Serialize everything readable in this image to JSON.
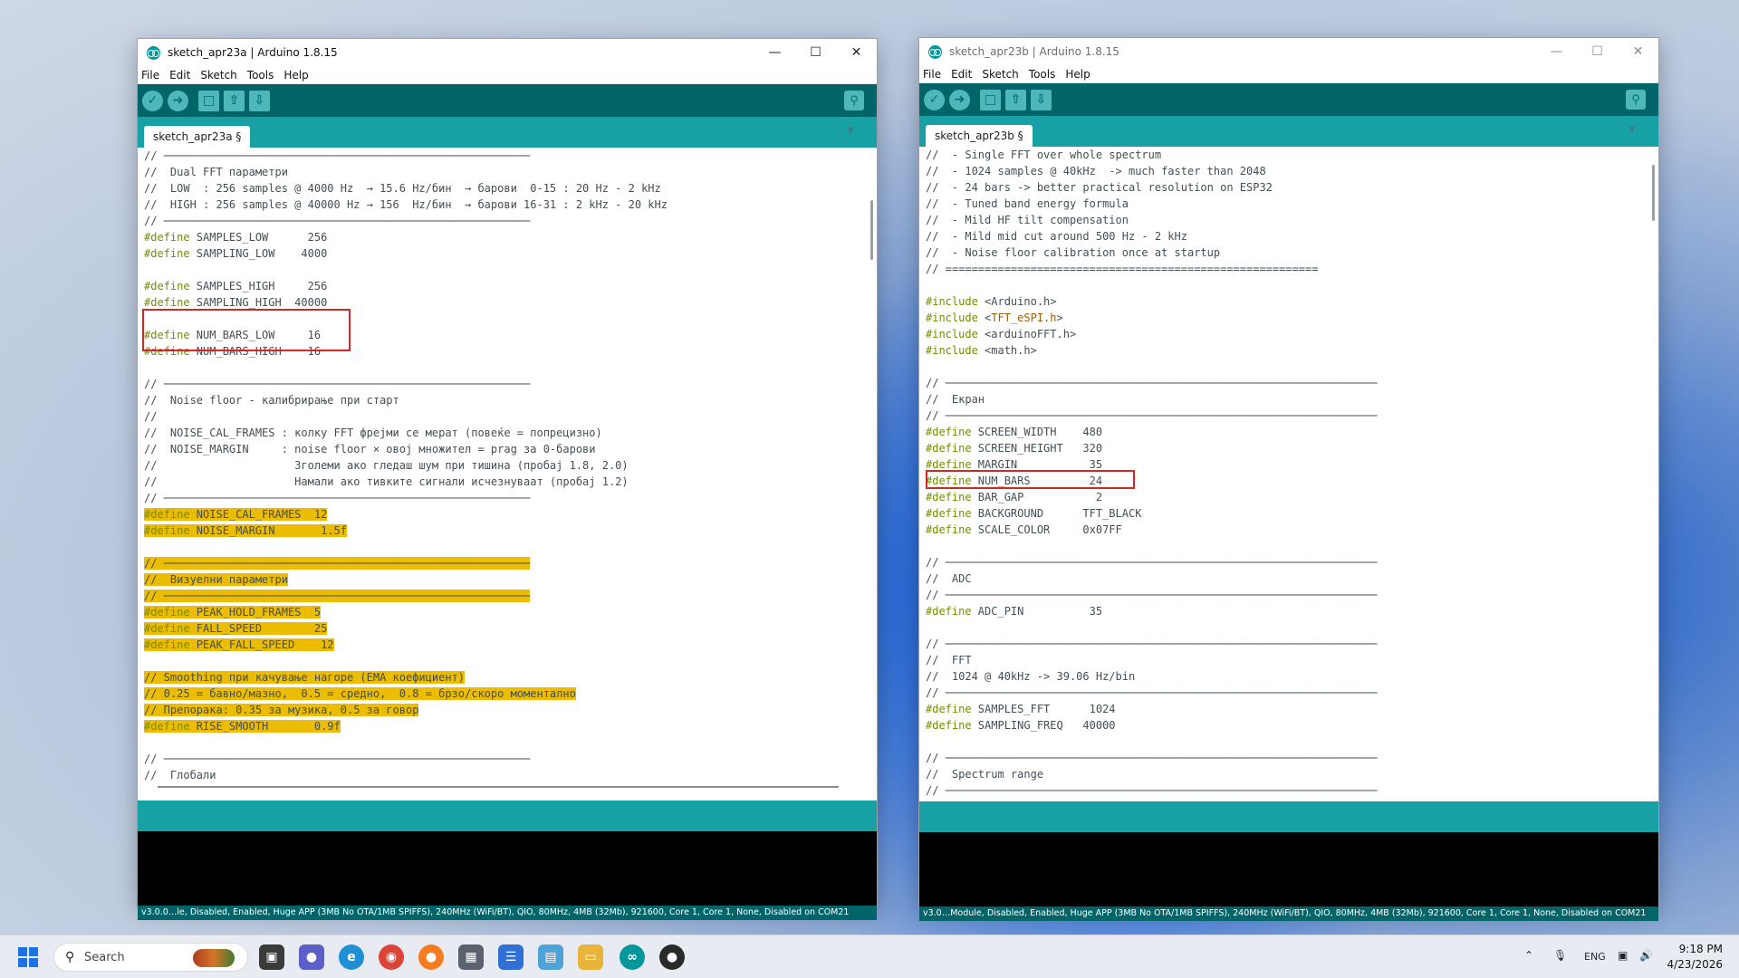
{
  "windows": [
    {
      "title": "sketch_apr23a | Arduino 1.8.15",
      "menu": [
        "File",
        "Edit",
        "Sketch",
        "Tools",
        "Help"
      ],
      "tab": "sketch_apr23a §",
      "footer": "v3.0.0…le, Disabled, Enabled, Huge APP (3MB No OTA/1MB SPIFFS), 240MHz (WiFi/BT), QIO, 80MHz, 4MB (32Mb), 921600, Core 1, Core 1, None, Disabled on COM21",
      "code": [
        "// ────────────────────────────────────────────────────────",
        "//  Dual FFT параметри",
        "//  LOW  : 256 samples @ 4000 Hz  → 15.6 Hz/бин  → барови  0-15 : 20 Hz - 2 kHz",
        "//  HIGH : 256 samples @ 40000 Hz → 156  Hz/бин  → барови 16-31 : 2 kHz - 20 kHz",
        "// ────────────────────────────────────────────────────────",
        "#define SAMPLES_LOW      256",
        "#define SAMPLING_LOW    4000",
        "",
        "#define SAMPLES_HIGH     256",
        "#define SAMPLING_HIGH  40000",
        "",
        "#define NUM_BARS_LOW     16",
        "#define NUM_BARS_HIGH    16",
        "",
        "// ────────────────────────────────────────────────────────",
        "//  Noise floor - калибрирање при старт",
        "//",
        "//  NOISE_CAL_FRAMES : колку FFT фрејми се мерат (повеќе = попрецизно)",
        "//  NOISE_MARGIN     : noise floor × овој множител = prag за 0-барови",
        "//                     Зголеми ако гледаш шум при тишина (пробај 1.8, 2.0)",
        "//                     Намали ако тивките сигнали исчезнуваат (пробај 1.2)",
        "// ────────────────────────────────────────────────────────",
        "#define NOISE_CAL_FRAMES  12",
        "#define NOISE_MARGIN       1.5f",
        "",
        "// ────────────────────────────────────────────────────────",
        "//  Визуелни параметри",
        "// ────────────────────────────────────────────────────────",
        "#define PEAK_HOLD_FRAMES  5",
        "#define FALL_SPEED        25",
        "#define PEAK_FALL_SPEED    12",
        "",
        "// Smoothing при качување нагоре (EMA коефициент)",
        "// 0.25 = бавно/мазно,  0.5 = средно,  0.8 = брзо/скоро моментално",
        "// Препорака: 0.35 за музика, 0.5 за говор",
        "#define RISE_SMOOTH       0.9f",
        "",
        "// ────────────────────────────────────────────────────────",
        "//  Глобали"
      ]
    },
    {
      "title": "sketch_apr23b | Arduino 1.8.15",
      "menu": [
        "File",
        "Edit",
        "Sketch",
        "Tools",
        "Help"
      ],
      "tab": "sketch_apr23b §",
      "footer": "v3.0…Module, Disabled, Enabled, Huge APP (3MB No OTA/1MB SPIFFS), 240MHz (WiFi/BT), QIO, 80MHz, 4MB (32Mb), 921600, Core 1, Core 1, None, Disabled on COM21",
      "code": [
        "//  - Single FFT over whole spectrum",
        "//  - 1024 samples @ 40kHz  -> much faster than 2048",
        "//  - 24 bars -> better practical resolution on ESP32",
        "//  - Tuned band energy formula",
        "//  - Mild HF tilt compensation",
        "//  - Mild mid cut around 500 Hz - 2 kHz",
        "//  - Noise floor calibration once at startup",
        "// =========================================================",
        "",
        "#include <Arduino.h>",
        "#include <TFT_eSPI.h>",
        "#include <arduinoFFT.h>",
        "#include <math.h>",
        "",
        "// ──────────────────────────────────────────────────────────────────",
        "//  Екран",
        "// ──────────────────────────────────────────────────────────────────",
        "#define SCREEN_WIDTH    480",
        "#define SCREEN_HEIGHT   320",
        "#define MARGIN           35",
        "#define NUM_BARS         24",
        "#define BAR_GAP           2",
        "#define BACKGROUND      TFT_BLACK",
        "#define SCALE_COLOR     0x07FF",
        "",
        "// ──────────────────────────────────────────────────────────────────",
        "//  ADC",
        "// ──────────────────────────────────────────────────────────────────",
        "#define ADC_PIN          35",
        "",
        "// ──────────────────────────────────────────────────────────────────",
        "//  FFT",
        "//  1024 @ 40kHz -> 39.06 Hz/bin",
        "// ──────────────────────────────────────────────────────────────────",
        "#define SAMPLES_FFT      1024",
        "#define SAMPLING_FREQ   40000",
        "",
        "// ──────────────────────────────────────────────────────────────────",
        "//  Spectrum range",
        "// ──────────────────────────────────────────────────────────────────"
      ]
    }
  ],
  "taskbar": {
    "search_placeholder": "Search",
    "tray_lang": "ENG",
    "time": "9:18 PM",
    "date": "4/23/2026"
  },
  "colors": {
    "teal_dark": "#006468",
    "teal": "#17a1a5",
    "highlight": "#ecbc00",
    "red_box": "#d32626"
  }
}
